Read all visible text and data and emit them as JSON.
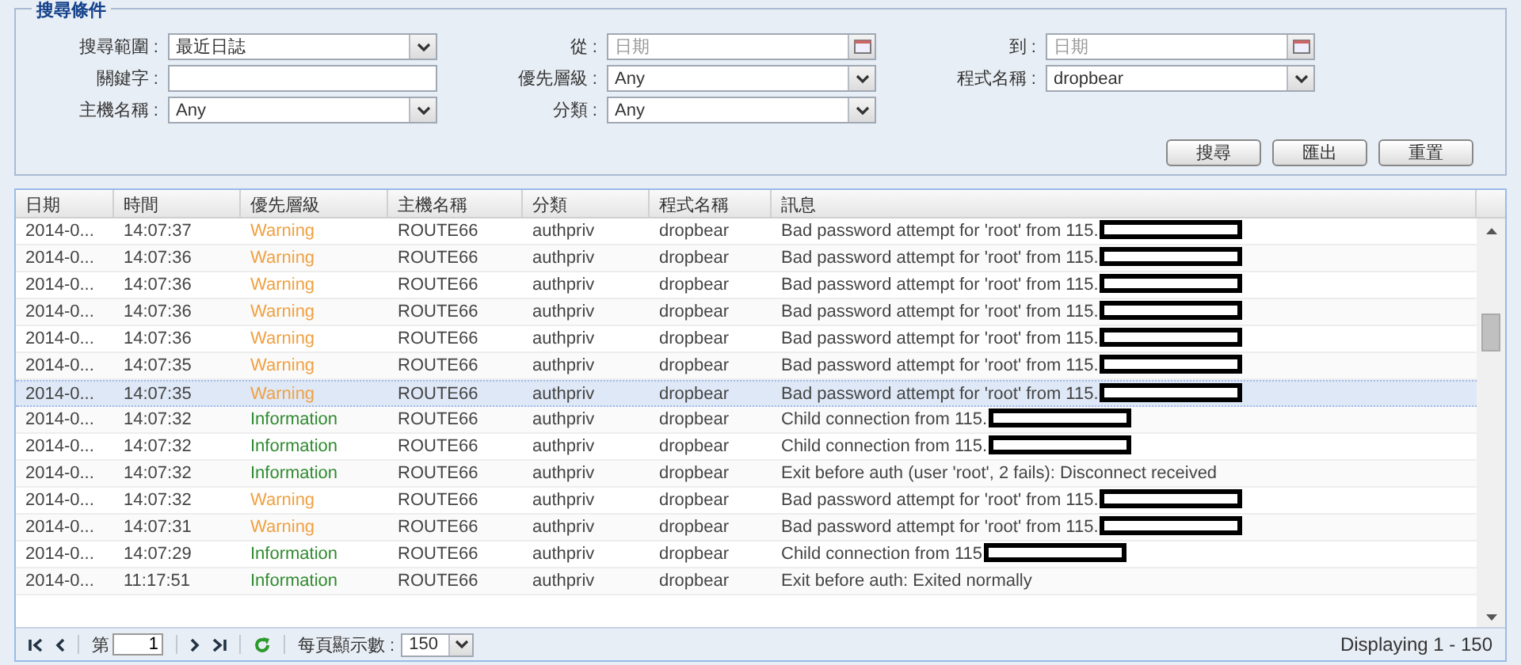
{
  "search_panel": {
    "legend": "搜尋條件",
    "fields": [
      {
        "label": "搜尋範圍 :",
        "kind": "combo",
        "value": "最近日誌"
      },
      {
        "label": "從 :",
        "kind": "date",
        "placeholder": "日期"
      },
      {
        "label": "到 :",
        "kind": "date",
        "placeholder": "日期"
      },
      {
        "label": "關鍵字 :",
        "kind": "text"
      },
      {
        "label": "優先層級 :",
        "kind": "combo",
        "value": "Any"
      },
      {
        "label": "程式名稱 :",
        "kind": "combo",
        "value": "dropbear"
      },
      {
        "label": "主機名稱 :",
        "kind": "combo",
        "value": "Any"
      },
      {
        "label": "分類 :",
        "kind": "combo",
        "value": "Any"
      }
    ],
    "buttons": [
      "搜尋",
      "匯出",
      "重置"
    ]
  },
  "table": {
    "columns": [
      "日期",
      "時間",
      "優先層級",
      "主機名稱",
      "分類",
      "程式名稱",
      "訊息"
    ],
    "rows": [
      {
        "date": "2014-0...",
        "time": "14:07:37",
        "level": "Warning",
        "host": "ROUTE66",
        "category": "authpriv",
        "program": "dropbear",
        "message": "Bad password attempt for 'root' from 115.",
        "redacted": true,
        "selected": false
      },
      {
        "date": "2014-0...",
        "time": "14:07:36",
        "level": "Warning",
        "host": "ROUTE66",
        "category": "authpriv",
        "program": "dropbear",
        "message": "Bad password attempt for 'root' from 115.",
        "redacted": true,
        "selected": false
      },
      {
        "date": "2014-0...",
        "time": "14:07:36",
        "level": "Warning",
        "host": "ROUTE66",
        "category": "authpriv",
        "program": "dropbear",
        "message": "Bad password attempt for 'root' from 115.",
        "redacted": true,
        "selected": false
      },
      {
        "date": "2014-0...",
        "time": "14:07:36",
        "level": "Warning",
        "host": "ROUTE66",
        "category": "authpriv",
        "program": "dropbear",
        "message": "Bad password attempt for 'root' from 115.",
        "redacted": true,
        "selected": false
      },
      {
        "date": "2014-0...",
        "time": "14:07:36",
        "level": "Warning",
        "host": "ROUTE66",
        "category": "authpriv",
        "program": "dropbear",
        "message": "Bad password attempt for 'root' from 115.",
        "redacted": true,
        "selected": false
      },
      {
        "date": "2014-0...",
        "time": "14:07:35",
        "level": "Warning",
        "host": "ROUTE66",
        "category": "authpriv",
        "program": "dropbear",
        "message": "Bad password attempt for 'root' from 115.",
        "redacted": true,
        "selected": false
      },
      {
        "date": "2014-0...",
        "time": "14:07:35",
        "level": "Warning",
        "host": "ROUTE66",
        "category": "authpriv",
        "program": "dropbear",
        "message": "Bad password attempt for 'root' from 115.",
        "redacted": true,
        "selected": true
      },
      {
        "date": "2014-0...",
        "time": "14:07:32",
        "level": "Information",
        "host": "ROUTE66",
        "category": "authpriv",
        "program": "dropbear",
        "message": "Child connection from 115.",
        "redacted": true,
        "selected": false
      },
      {
        "date": "2014-0...",
        "time": "14:07:32",
        "level": "Information",
        "host": "ROUTE66",
        "category": "authpriv",
        "program": "dropbear",
        "message": "Child connection from 115.",
        "redacted": true,
        "selected": false
      },
      {
        "date": "2014-0...",
        "time": "14:07:32",
        "level": "Information",
        "host": "ROUTE66",
        "category": "authpriv",
        "program": "dropbear",
        "message": "Exit before auth (user 'root', 2 fails): Disconnect received",
        "redacted": false,
        "selected": false
      },
      {
        "date": "2014-0...",
        "time": "14:07:32",
        "level": "Warning",
        "host": "ROUTE66",
        "category": "authpriv",
        "program": "dropbear",
        "message": "Bad password attempt for 'root' from 115.",
        "redacted": true,
        "selected": false
      },
      {
        "date": "2014-0...",
        "time": "14:07:31",
        "level": "Warning",
        "host": "ROUTE66",
        "category": "authpriv",
        "program": "dropbear",
        "message": "Bad password attempt for 'root' from 115.",
        "redacted": true,
        "selected": false
      },
      {
        "date": "2014-0...",
        "time": "14:07:29",
        "level": "Information",
        "host": "ROUTE66",
        "category": "authpriv",
        "program": "dropbear",
        "message": "Child connection from 115",
        "redacted": true,
        "selected": false
      },
      {
        "date": "2014-0...",
        "time": "11:17:51",
        "level": "Information",
        "host": "ROUTE66",
        "category": "authpriv",
        "program": "dropbear",
        "message": "Exit before auth: Exited normally",
        "redacted": false,
        "selected": false
      }
    ]
  },
  "paging": {
    "page_label": "第",
    "page": "1",
    "per_page_label": "每頁顯示數 :",
    "per_page": "150",
    "status": "Displaying 1 - 150"
  }
}
